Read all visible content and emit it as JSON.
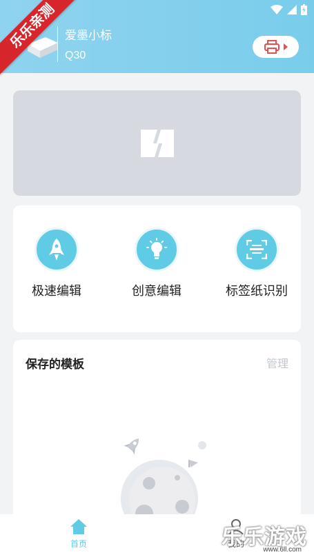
{
  "ribbon": "乐乐亲测",
  "device": {
    "name": "爱墨小标",
    "model": "Q30"
  },
  "features": [
    {
      "label": "极速编辑",
      "icon": "rocket-icon"
    },
    {
      "label": "创意编辑",
      "icon": "lightbulb-icon"
    },
    {
      "label": "标签纸识别",
      "icon": "scan-icon"
    }
  ],
  "templates": {
    "title": "保存的模板",
    "manage": "管理"
  },
  "tabs": [
    {
      "label": "首页",
      "icon": "home-icon",
      "active": true
    },
    {
      "label": "我的",
      "icon": "user-icon",
      "active": false
    }
  ],
  "watermark": {
    "text": "乐乐游戏",
    "url": "www.6ll.com"
  },
  "colors": {
    "accent": "#5fcbe4",
    "header": "#7fcfed",
    "ribbon": "#d7262b",
    "print": "#e94e4e"
  }
}
